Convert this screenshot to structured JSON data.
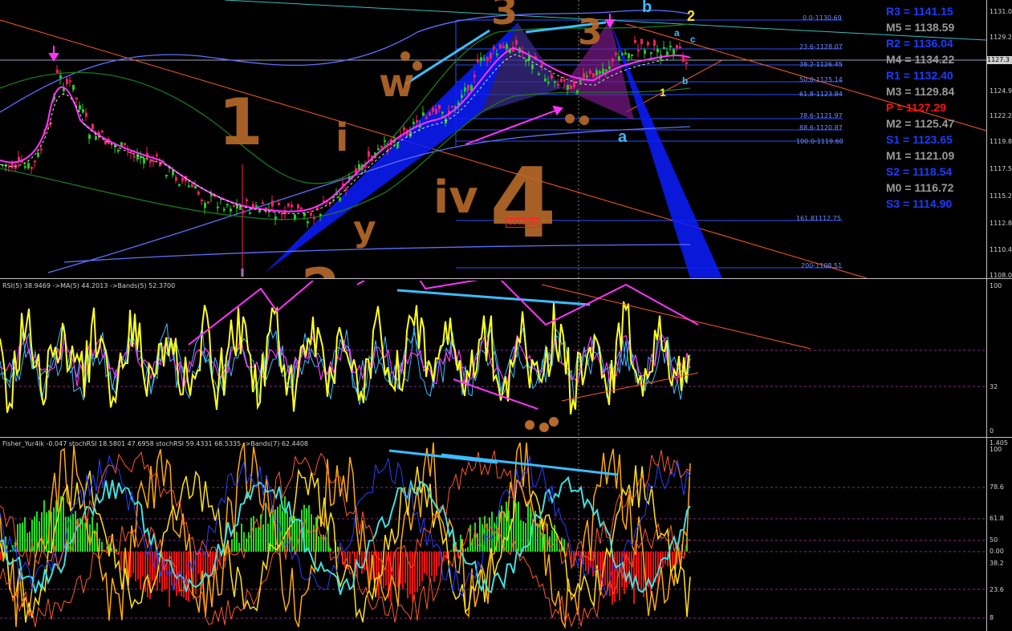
{
  "main": {
    "price_axis": [
      "1131.0",
      "1129.2",
      "1127.4",
      "1124.9",
      "1122.2",
      "1119.8",
      "1117.5",
      "1115.2",
      "1112.8",
      "1110.4",
      "1108.0"
    ],
    "current_price": "1127.3",
    "box_label": "1112.80",
    "fib_levels": [
      "0.0-1130.69",
      "23.6-1128.07",
      "38.2-1126.45",
      "50.0-1125.14",
      "61.8-1123.84",
      "78.6-1121.97",
      "88.6-1120.87",
      "100.0-1119.60",
      "161.81112.75",
      "200-1108.51"
    ],
    "pivots": [
      {
        "text": "R3 = 1141.15",
        "color": "#1b3cff"
      },
      {
        "text": "M5 = 1138.59",
        "color": "#9a9a9a"
      },
      {
        "text": "R2 = 1136.04",
        "color": "#1b3cff"
      },
      {
        "text": "M4 = 1134.22",
        "color": "#9a9a9a"
      },
      {
        "text": "R1 = 1132.40",
        "color": "#1b3cff"
      },
      {
        "text": "M3 = 1129.84",
        "color": "#9a9a9a"
      },
      {
        "text": "P = 1127.29",
        "color": "#ff1010"
      },
      {
        "text": "M2 = 1125.47",
        "color": "#9a9a9a"
      },
      {
        "text": "S1 = 1123.65",
        "color": "#1b3cff"
      },
      {
        "text": "M1 = 1121.09",
        "color": "#9a9a9a"
      },
      {
        "text": "S2 = 1118.54",
        "color": "#1b3cff"
      },
      {
        "text": "M0 = 1116.72",
        "color": "#9a9a9a"
      },
      {
        "text": "S3 = 1114.90",
        "color": "#1b3cff"
      }
    ],
    "wave_labels": [
      "b",
      "2",
      "a",
      "c",
      "b",
      "1",
      "a"
    ]
  },
  "rsi": {
    "title": "RSI(5) 38.9469  ->MA(5) 44.2013  ->Bands(5) 52.3700",
    "axis": [
      "100",
      "32",
      "0"
    ]
  },
  "fisher": {
    "title": "Fisher_Yur4ik -0.047  stochRSI 18.5801 47.6958  stochRSI 59.4331 68.5335  ->Bands(7) 62.4408",
    "axis": [
      "1.405",
      "100",
      "78.6",
      "61.8",
      "50",
      "0.00",
      "38.2",
      "23.6",
      "8"
    ]
  },
  "colors": {
    "background": "#000000",
    "bull_candle": "#22cc22",
    "bear_candle": "#ff2060",
    "ma_magenta": "#ff33ff",
    "band_blue": "#5f6fff",
    "band_green": "#1c7a1c",
    "rsi_yellow": "#ffff20",
    "fisher_green": "#22dd22",
    "fisher_red": "#ee1010",
    "annotation_orange": "#b86a2a"
  }
}
